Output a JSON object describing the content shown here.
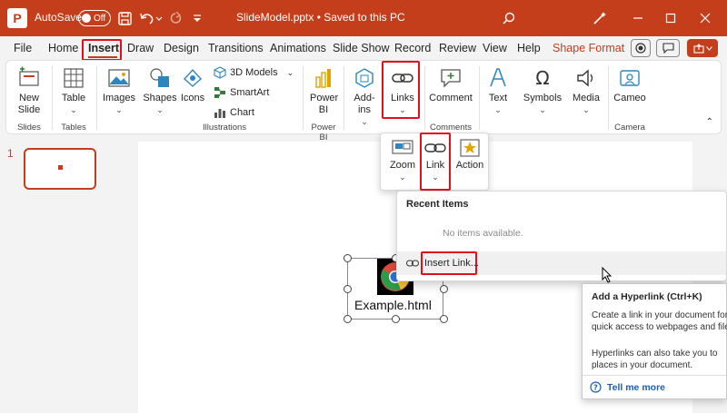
{
  "titlebar": {
    "autosave_label": "AutoSave",
    "autosave_state": "Off",
    "doc_title": "SlideModel.pptx  •  Saved to this PC",
    "bg_color": "#c43e1c"
  },
  "tabs": [
    {
      "label": "File"
    },
    {
      "label": "Home"
    },
    {
      "label": "Insert"
    },
    {
      "label": "Draw"
    },
    {
      "label": "Design"
    },
    {
      "label": "Transitions"
    },
    {
      "label": "Animations"
    },
    {
      "label": "Slide Show"
    },
    {
      "label": "Record"
    },
    {
      "label": "Review"
    },
    {
      "label": "View"
    },
    {
      "label": "Help"
    },
    {
      "label": "Shape Format"
    }
  ],
  "ribbon": {
    "new_slide": "New Slide",
    "table": "Table",
    "images": "Images",
    "shapes": "Shapes",
    "icons": "Icons",
    "models_3d": "3D Models",
    "smartart": "SmartArt",
    "chart": "Chart",
    "power_bi": "Power BI",
    "addins": "Add-ins",
    "links": "Links",
    "comment": "Comment",
    "text": "Text",
    "symbols": "Symbols",
    "media": "Media",
    "cameo": "Cameo",
    "groups": {
      "slides": "Slides",
      "tables": "Tables",
      "illustrations": "Illustrations",
      "power_bi": "Power BI",
      "comments": "Comments",
      "camera": "Camera"
    }
  },
  "slide_number": "1",
  "links_dropdown": {
    "zoom": "Zoom",
    "link": "Link",
    "action": "Action"
  },
  "link_menu": {
    "header": "Recent Items",
    "empty": "No items available.",
    "insert_link": "Insert Link..."
  },
  "slide_object": {
    "filename": "Example.html"
  },
  "tooltip": {
    "title": "Add a Hyperlink (Ctrl+K)",
    "body1": "Create a link in your document for quick access to webpages and files.",
    "body2": "Hyperlinks can also take you to places in your document.",
    "tell_more": "Tell me more"
  }
}
